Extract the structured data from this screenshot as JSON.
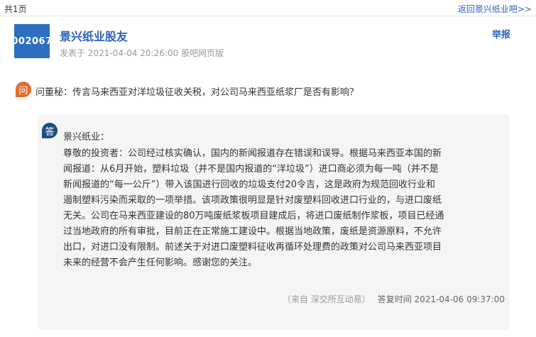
{
  "topbar": {
    "page_count": "共1页",
    "back_link": "返回景兴纸业吧>>"
  },
  "post": {
    "avatar_code": "002067",
    "username": "景兴纸业股友",
    "meta": "发表于 2021-04-04 20:26:00 股吧网页版",
    "report_label": "举报"
  },
  "qa": {
    "question_icon": "问",
    "question": "问董秘：传言马来西亚对洋垃圾征收关税，对公司马来西亚纸浆厂是否有影响？",
    "answer_icon": "答",
    "company_line": "景兴纸业：",
    "answer_lines": [
      "尊敬的投资者：公司经过核实确认，国内的新闻报道存在错误和误导。根据马来西亚本国的新",
      "闻报道：从6月开始，塑料垃圾（并不是国内报道的“洋垃圾”）进口商必须为每一吨（并不是",
      "新闻报道的“每一公斤”）带入该国进行回收的垃圾支付20令吉，这是政府为规范回收行业和",
      "遏制塑料污染而采取的一项举措。该项政策很明显是针对废塑料回收进口行业的，与进口废纸",
      "无关。公司在马来西亚建设的80万吨废纸浆板项目建成后，将进口废纸制作浆板，项目已经通",
      "过当地政府的所有审批，目前正在正常施工建设中。根据当地政策，废纸是资源原料，不允许",
      "出口，对进口没有限制。前述关于对进口废塑料征收再循环处理费的政策对公司马来西亚项目",
      "未来的经营不会产生任何影响。感谢您的关注。"
    ],
    "source": "（来自 深交所互动易）",
    "reply_time": "答复时间 2021-04-06 09:37:00"
  }
}
